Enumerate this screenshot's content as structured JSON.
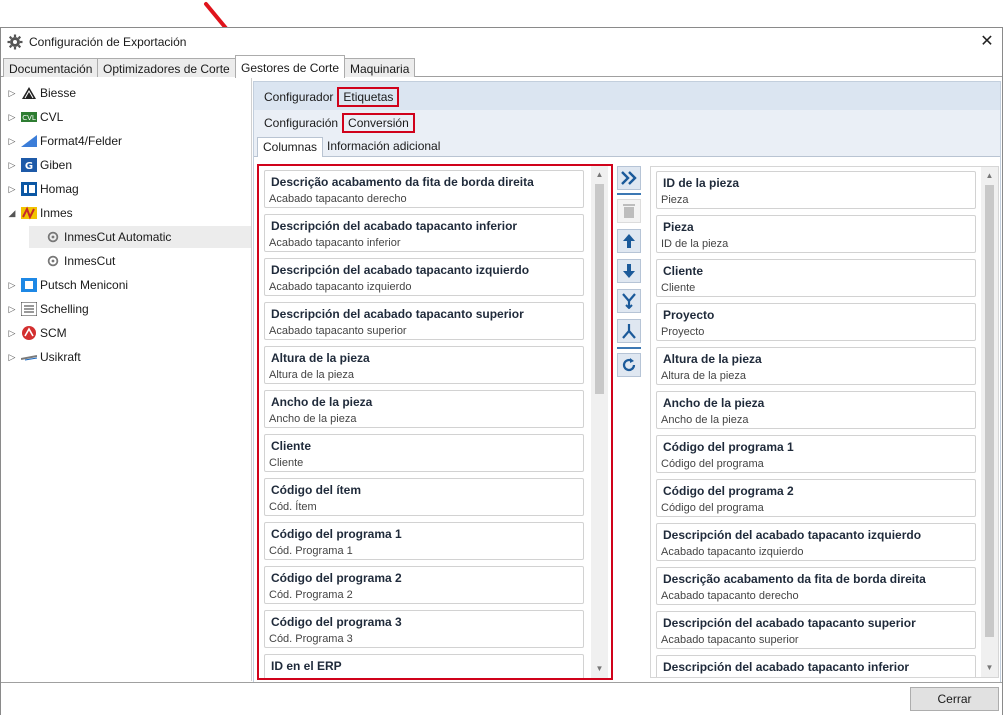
{
  "window": {
    "title": "Configuración de Exportación",
    "close_icon": "close-icon"
  },
  "main_tabs": [
    {
      "label": "Documentación"
    },
    {
      "label": "Optimizadores de Corte"
    },
    {
      "label": "Gestores de Corte",
      "active": true
    },
    {
      "label": "Maquinaria"
    }
  ],
  "tree": [
    {
      "label": "Biesse",
      "icon": "biesse-logo-icon",
      "expanded": false
    },
    {
      "label": "CVL",
      "icon": "cvl-logo-icon",
      "expanded": false
    },
    {
      "label": "Format4/Felder",
      "icon": "format4-logo-icon",
      "expanded": false
    },
    {
      "label": "Giben",
      "icon": "giben-logo-icon",
      "expanded": false
    },
    {
      "label": "Homag",
      "icon": "homag-logo-icon",
      "expanded": false
    },
    {
      "label": "Inmes",
      "icon": "inmes-logo-icon",
      "expanded": true
    },
    {
      "label": "InmesCut Automatic",
      "icon": "gear-icon",
      "child": true,
      "selected": true
    },
    {
      "label": "InmesCut",
      "icon": "gear-icon",
      "child": true
    },
    {
      "label": "Putsch Meniconi",
      "icon": "putsch-logo-icon",
      "expanded": false
    },
    {
      "label": "Schelling",
      "icon": "schelling-logo-icon",
      "expanded": false
    },
    {
      "label": "SCM",
      "icon": "scm-logo-icon",
      "expanded": false
    },
    {
      "label": "Usikraft",
      "icon": "usikraft-logo-icon",
      "expanded": false
    }
  ],
  "subtabs1": {
    "configurador": "Configurador",
    "etiquetas": "Etiquetas"
  },
  "subtabs2": {
    "configuracion": "Configuración",
    "conversion": "Conversión"
  },
  "inner_tabs": {
    "columnas": "Columnas",
    "info": "Información adicional"
  },
  "available_columns": [
    {
      "title": "Descrição acabamento da fita de borda direita",
      "sub": "Acabado tapacanto derecho"
    },
    {
      "title": "Descripción del acabado tapacanto inferior",
      "sub": "Acabado tapacanto inferior"
    },
    {
      "title": "Descripción del acabado tapacanto izquierdo",
      "sub": "Acabado tapacanto izquierdo"
    },
    {
      "title": "Descripción del acabado tapacanto superior",
      "sub": "Acabado tapacanto superior"
    },
    {
      "title": "Altura de la pieza",
      "sub": "Altura de la pieza"
    },
    {
      "title": "Ancho de la pieza",
      "sub": "Ancho de la pieza"
    },
    {
      "title": "Cliente",
      "sub": "Cliente"
    },
    {
      "title": "Código del ítem",
      "sub": "Cód. Ítem"
    },
    {
      "title": "Código del programa 1",
      "sub": "Cód. Programa 1"
    },
    {
      "title": "Código del programa 2",
      "sub": "Cód. Programa 2"
    },
    {
      "title": "Código del programa 3",
      "sub": "Cód. Programa 3"
    },
    {
      "title": "ID en el ERP",
      "sub": ""
    }
  ],
  "selected_columns": [
    {
      "title": "ID de la pieza",
      "sub": "Pieza"
    },
    {
      "title": "Pieza",
      "sub": "ID de la pieza"
    },
    {
      "title": "Cliente",
      "sub": "Cliente"
    },
    {
      "title": "Proyecto",
      "sub": "Proyecto"
    },
    {
      "title": "Altura de la pieza",
      "sub": "Altura de la pieza"
    },
    {
      "title": "Ancho de la pieza",
      "sub": "Ancho de la pieza"
    },
    {
      "title": "Código del programa 1",
      "sub": "Código del programa"
    },
    {
      "title": "Código del programa 2",
      "sub": "Código del programa"
    },
    {
      "title": "Descripción del acabado tapacanto izquierdo",
      "sub": "Acabado tapacanto izquierdo"
    },
    {
      "title": "Descrição acabamento da fita de borda direita",
      "sub": "Acabado tapacanto derecho"
    },
    {
      "title": "Descripción del acabado tapacanto superior",
      "sub": "Acabado tapacanto superior"
    },
    {
      "title": "Descripción del acabado tapacanto inferior",
      "sub": ""
    }
  ],
  "tools": [
    {
      "icon": "move-all-right-icon",
      "enabled": true
    },
    {
      "icon": "trash-icon",
      "enabled": false
    },
    {
      "icon": "arrow-up-icon",
      "enabled": true
    },
    {
      "icon": "arrow-down-icon",
      "enabled": true
    },
    {
      "icon": "merge-icon",
      "enabled": true
    },
    {
      "icon": "split-icon",
      "enabled": true
    },
    {
      "icon": "refresh-icon",
      "enabled": true
    }
  ],
  "footer": {
    "close_label": "Cerrar"
  },
  "colors": {
    "accent": "#3c78b4",
    "highlight_red": "#d0021b",
    "panel_bg": "#dbe5f1"
  }
}
